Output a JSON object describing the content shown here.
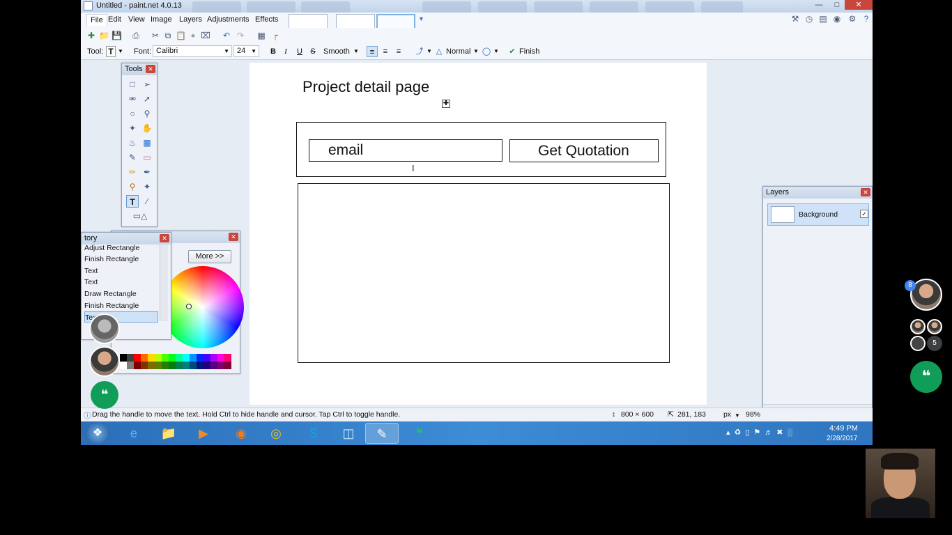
{
  "window": {
    "title": "Untitled - paint.net 4.0.13"
  },
  "menubar": {
    "items": [
      "File",
      "Edit",
      "View",
      "Image",
      "Layers",
      "Adjustments",
      "Effects"
    ]
  },
  "toolbar": {
    "tool_label": "Tool:",
    "font_label": "Font:",
    "font_value": "Calibri",
    "size_value": "24",
    "antialias_value": "Smooth",
    "blend_value": "Normal",
    "finish_label": "Finish"
  },
  "canvas": {
    "heading": "Project detail page",
    "email_label": "email",
    "quote_label": "Get Quotation"
  },
  "tools_panel": {
    "title": "Tools"
  },
  "history_panel": {
    "title": "tory",
    "items": [
      "Adjust Rectangle",
      "Finish Rectangle",
      "Text",
      "Text",
      "Draw Rectangle",
      "Finish Rectangle",
      "Text"
    ]
  },
  "colors_panel": {
    "more_label": "More >>",
    "palette": [
      "#000000",
      "#404040",
      "#ff0000",
      "#ff6a00",
      "#ffd800",
      "#b6ff00",
      "#4cff00",
      "#00ff21",
      "#00ff90",
      "#00ffff",
      "#0094ff",
      "#0026ff",
      "#4800ff",
      "#b200ff",
      "#ff00dc",
      "#ff006e",
      "#ffffff",
      "#808080",
      "#7f0000",
      "#7f3300",
      "#7f6a00",
      "#5b7f00",
      "#267f00",
      "#007f0e",
      "#007f46",
      "#007f7f",
      "#004a7f",
      "#00137f",
      "#21007f",
      "#57007f",
      "#7f006e",
      "#7f0037"
    ]
  },
  "layers_panel": {
    "title": "Layers",
    "layer_name": "Background"
  },
  "statusbar": {
    "hint": "Drag the handle to move the text. Hold Ctrl to hide handle and cursor. Tap Ctrl to toggle handle.",
    "image_size": "800 × 600",
    "cursor_pos": "281, 183",
    "units": "px",
    "zoom": "98%"
  },
  "taskbar": {
    "time": "4:49 PM",
    "date": "2/28/2017"
  },
  "hangouts": {
    "participants_badge": "8",
    "more_count": "5"
  }
}
